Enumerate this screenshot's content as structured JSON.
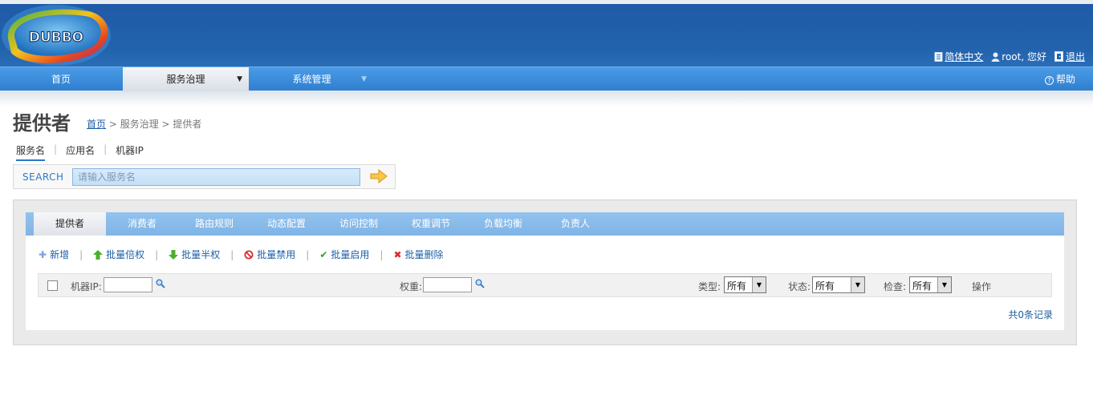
{
  "header": {
    "logo_text": "DUBBO",
    "lang_label": "简体中文",
    "greeting": "root, 您好",
    "logout_label": "退出"
  },
  "nav": {
    "items": [
      {
        "label": "首页"
      },
      {
        "label": "服务治理"
      },
      {
        "label": "系统管理"
      }
    ],
    "help_label": "帮助"
  },
  "page": {
    "title": "提供者",
    "breadcrumb": {
      "home": "首页",
      "rest": " > 服务治理 > 提供者"
    }
  },
  "search": {
    "tabs": [
      "服务名",
      "应用名",
      "机器IP"
    ],
    "label": "SEARCH",
    "placeholder": "请输入服务名"
  },
  "tabs": [
    "提供者",
    "消费者",
    "路由规则",
    "动态配置",
    "访问控制",
    "权重调节",
    "负载均衡",
    "负责人"
  ],
  "toolbar": {
    "add": "新增",
    "double": "批量倍权",
    "half": "批量半权",
    "disable": "批量禁用",
    "enable": "批量启用",
    "delete": "批量删除"
  },
  "filter": {
    "ip_label": "机器IP:",
    "weight_label": "权重:",
    "type_label": "类型:",
    "type_value": "所有",
    "status_label": "状态:",
    "status_value": "所有",
    "check_label": "检查:",
    "check_value": "所有",
    "ops_label": "操作"
  },
  "records": "共0条记录",
  "colors": {
    "header_bg": "#2262ad",
    "nav_bg": "#3a8ddb",
    "tabbar_bg": "#8bbdea",
    "link": "#1f5fa6"
  }
}
